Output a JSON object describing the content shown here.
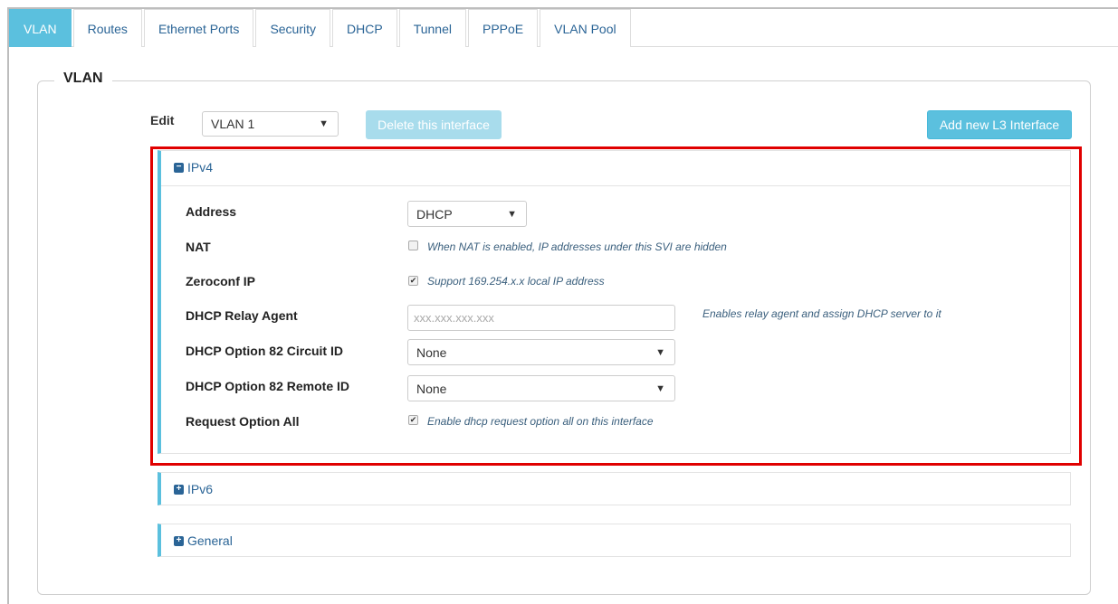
{
  "tabs": [
    {
      "label": "VLAN",
      "active": true
    },
    {
      "label": "Routes"
    },
    {
      "label": "Ethernet Ports"
    },
    {
      "label": "Security"
    },
    {
      "label": "DHCP"
    },
    {
      "label": "Tunnel"
    },
    {
      "label": "PPPoE"
    },
    {
      "label": "VLAN Pool"
    }
  ],
  "section": {
    "legend": "VLAN"
  },
  "edit": {
    "label": "Edit",
    "selected": "VLAN 1"
  },
  "buttons": {
    "delete": "Delete this interface",
    "add": "Add new L3 Interface"
  },
  "ipv4": {
    "title": "IPv4",
    "address": {
      "label": "Address",
      "selected": "DHCP"
    },
    "nat": {
      "label": "NAT",
      "checked": false,
      "hint": "When NAT is enabled, IP addresses under this SVI are hidden"
    },
    "zeroconf": {
      "label": "Zeroconf IP",
      "checked": true,
      "hint": "Support 169.254.x.x local IP address"
    },
    "relay": {
      "label": "DHCP Relay Agent",
      "placeholder": "xxx.xxx.xxx.xxx",
      "hint": "Enables relay agent and assign DHCP server to it"
    },
    "circuit": {
      "label": "DHCP Option 82 Circuit ID",
      "selected": "None"
    },
    "remote": {
      "label": "DHCP Option 82 Remote ID",
      "selected": "None"
    },
    "request_all": {
      "label": "Request Option All",
      "checked": true,
      "hint": "Enable dhcp request option all on this interface"
    }
  },
  "ipv6": {
    "title": "IPv6"
  },
  "general": {
    "title": "General"
  },
  "icons": {
    "collapse": "minus-square-icon",
    "expand": "plus-square-icon",
    "dropdown": "caret-down-icon"
  },
  "colors": {
    "accent": "#5bc0de",
    "link": "#2a6496",
    "highlight": "#e00000"
  }
}
